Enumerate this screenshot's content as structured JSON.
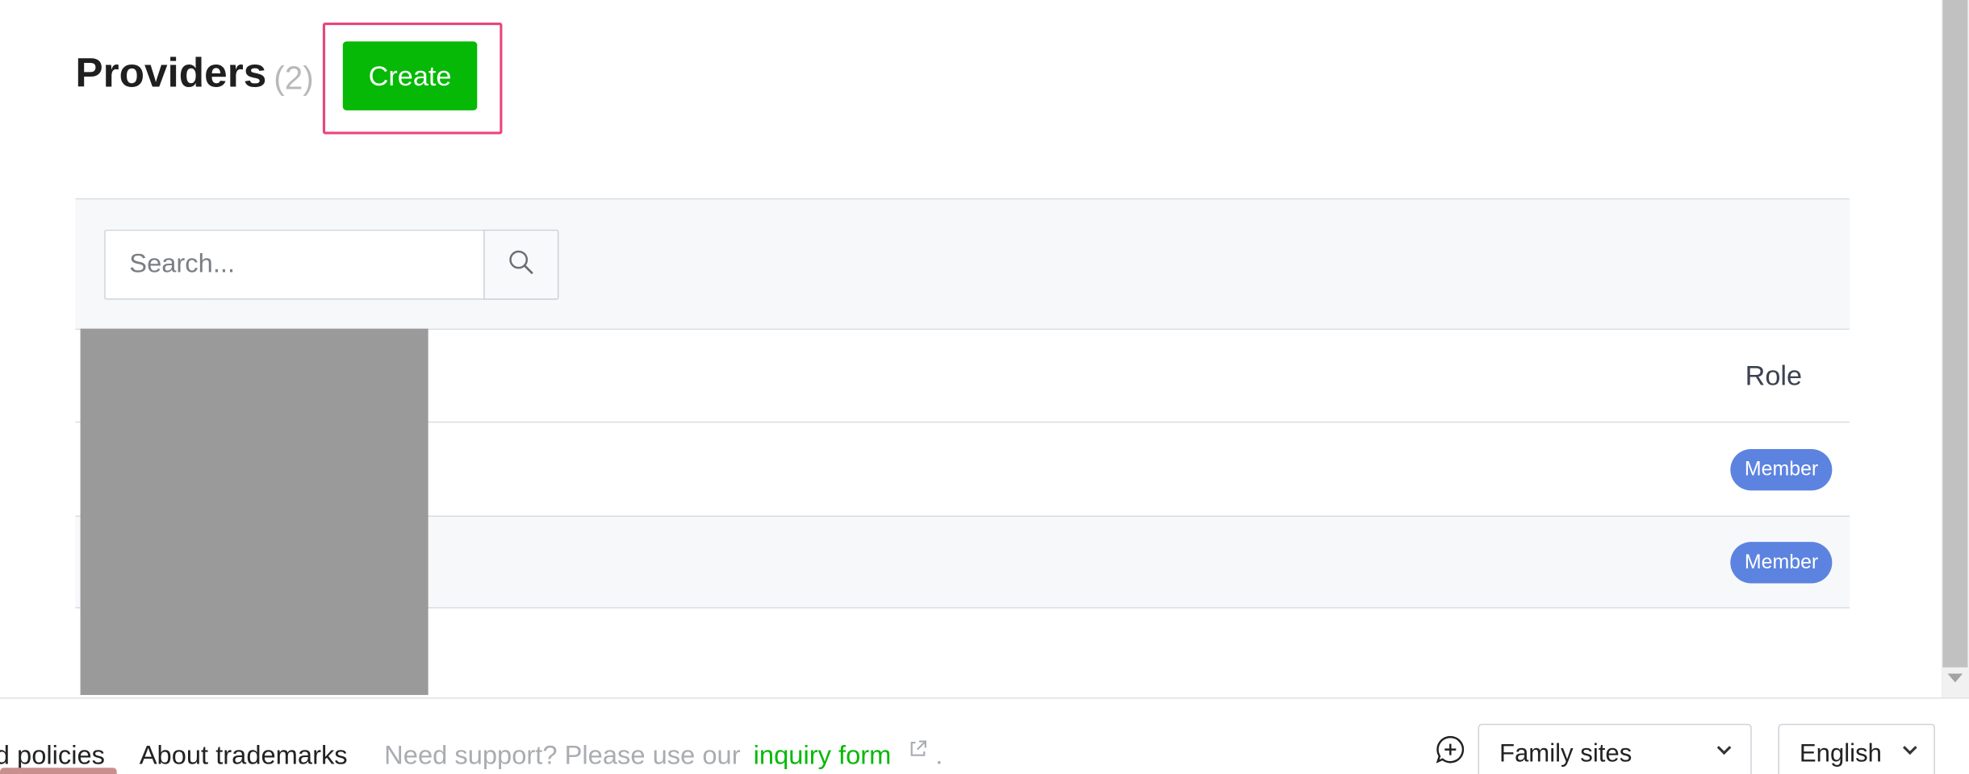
{
  "header": {
    "title": "Providers",
    "count": "(2)",
    "create_label": "Create"
  },
  "search": {
    "placeholder": "Search...",
    "value": ""
  },
  "table": {
    "columns": [
      "Role"
    ],
    "rows": [
      {
        "role": "Member"
      },
      {
        "role": "Member"
      }
    ]
  },
  "footer": {
    "policies_label": "d policies",
    "trademarks_label": "About trademarks",
    "support_text": "Need support? Please use our",
    "inquiry_label": "inquiry form",
    "period": ".",
    "family_sites_label": "Family sites",
    "language_label": "English"
  },
  "colors": {
    "primary_green": "#06b906",
    "badge_blue": "#5c83e0",
    "highlight_pink": "#e8457d"
  },
  "icons": [
    "search-icon",
    "external-link-icon",
    "chat-plus-icon",
    "chevron-down-icon"
  ]
}
